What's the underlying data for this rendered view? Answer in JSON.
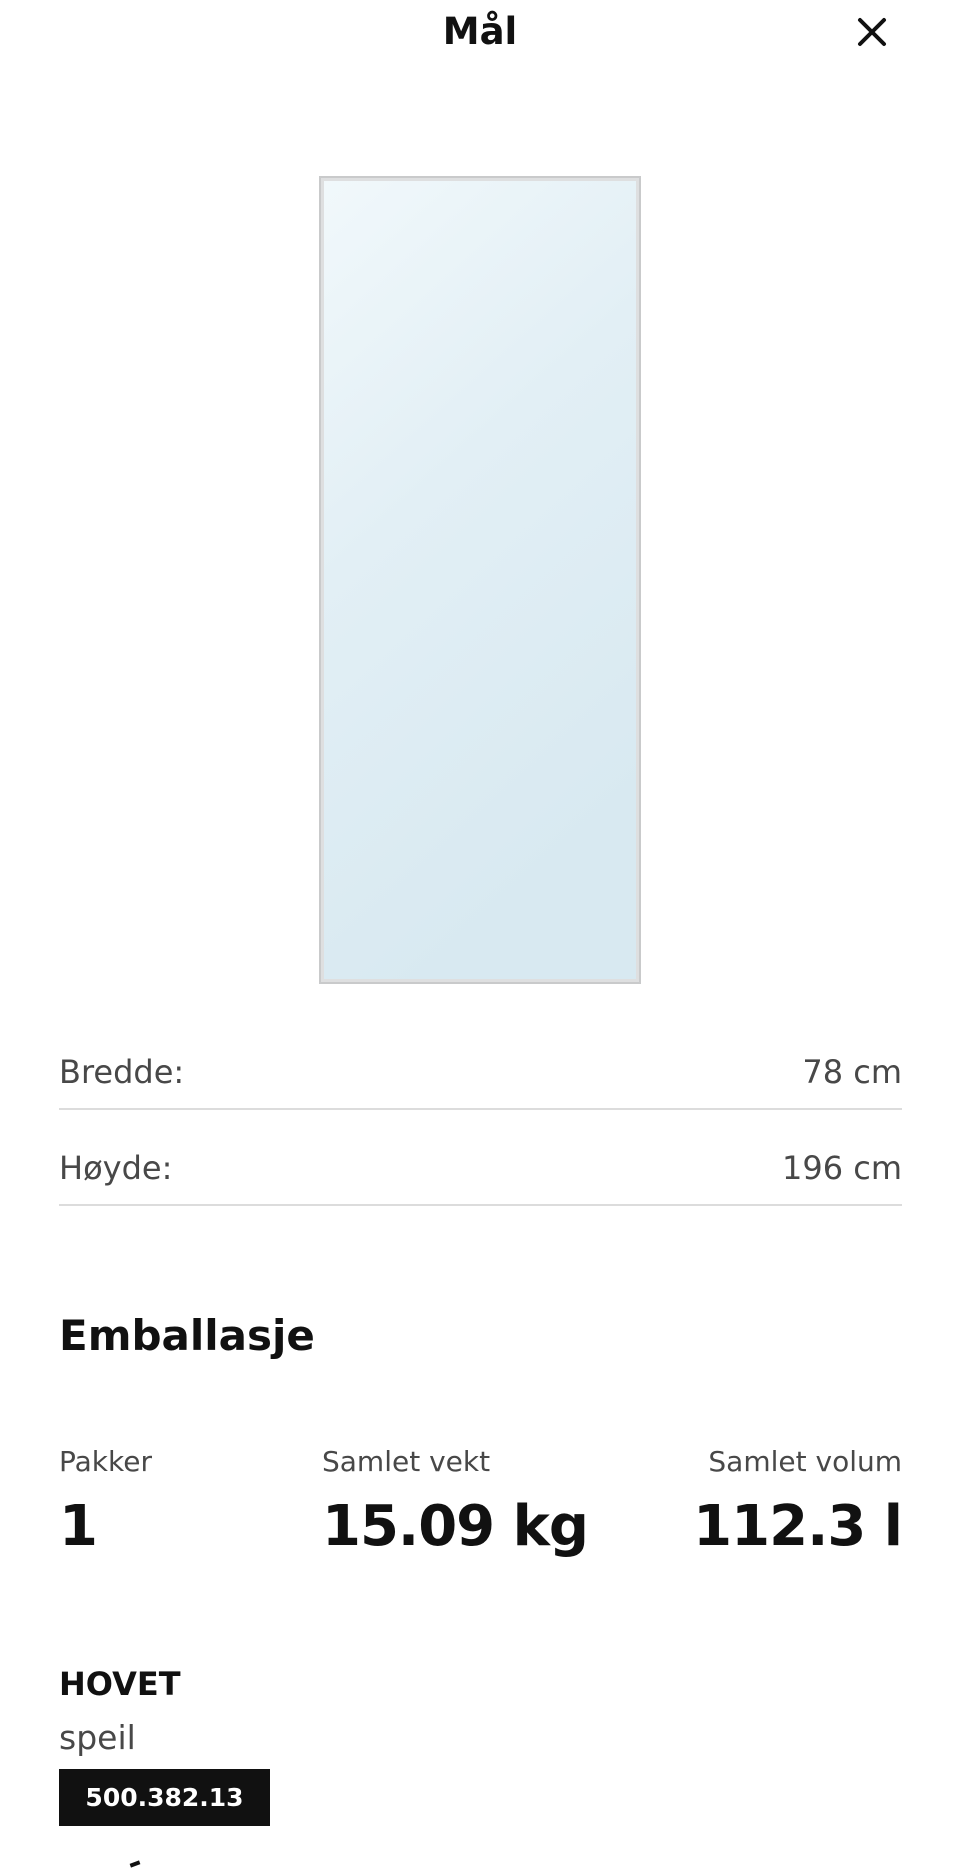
{
  "header": {
    "title": "Mål",
    "close_icon": "close-icon"
  },
  "product_image": {
    "description_icon": "mirror-image",
    "frame_color": "#c9cacb",
    "glass_color": "#dcecf3"
  },
  "dimensions": [
    {
      "label": "Bredde:",
      "value": "78 cm"
    },
    {
      "label": "Høyde:",
      "value": "196 cm"
    }
  ],
  "packaging": {
    "title": "Emballasje",
    "stats": [
      {
        "label": "Pakker",
        "value": "1"
      },
      {
        "label": "Samlet vekt",
        "value": "15.09 kg"
      },
      {
        "label": "Samlet volum",
        "value": "112.3 l"
      }
    ],
    "product": {
      "name": "HOVET",
      "description": "speil",
      "article_number": "500.382.13"
    }
  }
}
